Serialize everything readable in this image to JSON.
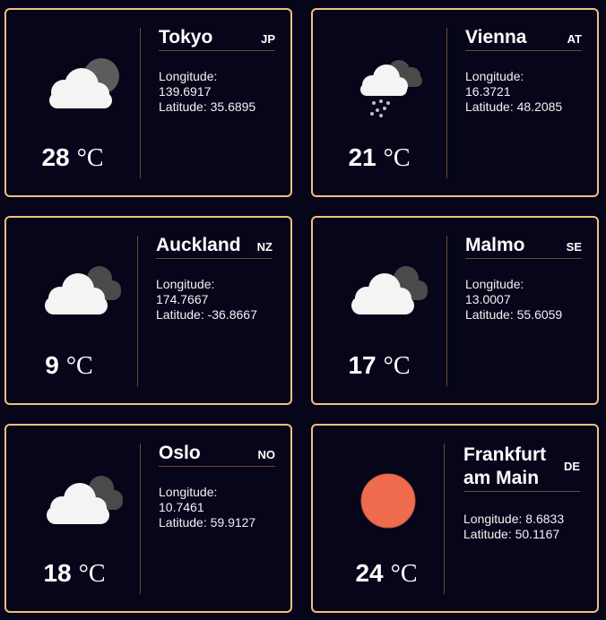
{
  "labels": {
    "longitude_prefix": "Longitude: ",
    "latitude_prefix": "Latitude: ",
    "unit": "°C"
  },
  "cards": [
    {
      "city": "Tokyo",
      "country": "JP",
      "temp": "28",
      "longitude": "139.6917",
      "latitude": "35.6895",
      "icon": "cloud-moon-icon"
    },
    {
      "city": "Vienna",
      "country": "AT",
      "temp": "21",
      "longitude": "16.3721",
      "latitude": "48.2085",
      "icon": "rain-cloud-icon"
    },
    {
      "city": "Auckland",
      "country": "NZ",
      "temp": "9",
      "longitude": "174.7667",
      "latitude": "-36.8667",
      "icon": "clouds-icon"
    },
    {
      "city": "Malmo",
      "country": "SE",
      "temp": "17",
      "longitude": "13.0007",
      "latitude": "55.6059",
      "icon": "clouds-icon"
    },
    {
      "city": "Oslo",
      "country": "NO",
      "temp": "18",
      "longitude": "10.7461",
      "latitude": "59.9127",
      "icon": "clouds-icon"
    },
    {
      "city": "Frankfurt am Main",
      "country": "DE",
      "temp": "24",
      "longitude": "8.6833",
      "latitude": "50.1167",
      "icon": "sun-icon"
    }
  ],
  "colors": {
    "card_border": "#f0c27a",
    "background": "#06051a",
    "sun": "#ee6c4d",
    "cloud_front": "#f4f4f4",
    "cloud_back": "#4a4a4a",
    "moon": "#5c5c5c"
  }
}
